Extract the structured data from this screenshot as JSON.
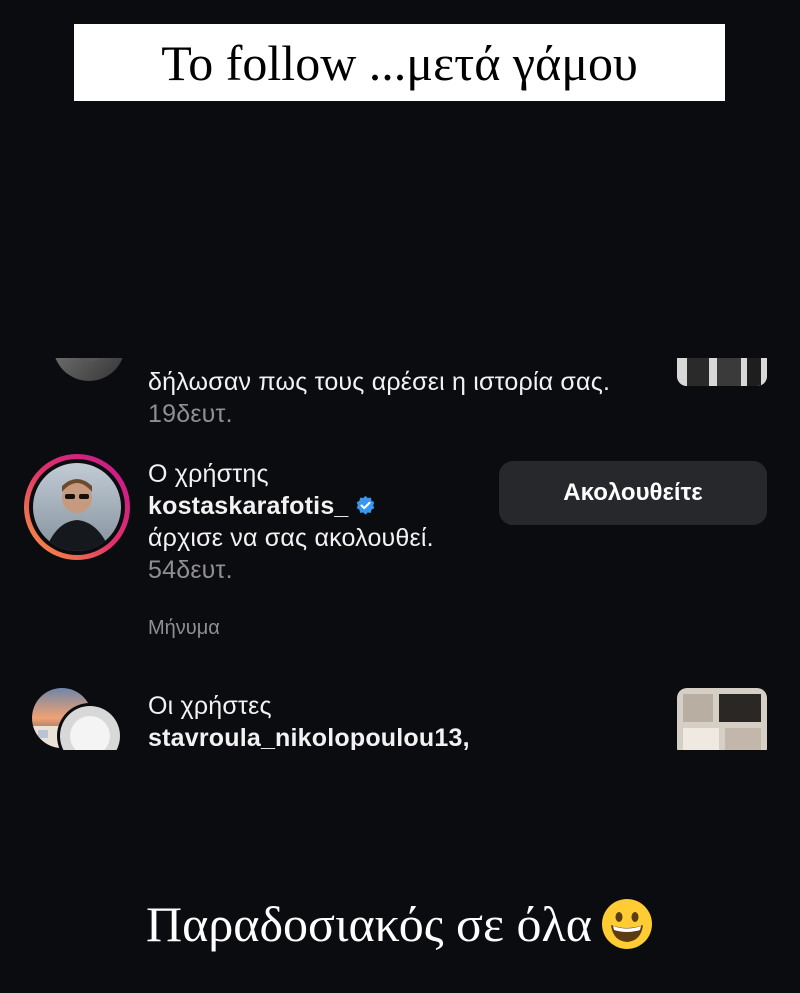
{
  "header": {
    "title": "To follow ...μετά γάμου"
  },
  "notifications": [
    {
      "text": "δήλωσαν πως τους αρέσει η ιστορία σας.",
      "time": "19δευτ."
    },
    {
      "prefix": "Ο χρήστης",
      "username": "kostaskarafotis_",
      "verified": true,
      "message": "άρχισε να σας ακολουθεί.",
      "time": "54δευτ.",
      "action_label": "Ακολουθείτε",
      "reply_label": "Μήνυμα"
    },
    {
      "prefix": "Οι χρήστες",
      "usernames": "stavroula_nikolopoulou13,"
    }
  ],
  "caption": {
    "text": "Παραδοσιακός σε όλα",
    "emoji": "grinning-face"
  },
  "colors": {
    "background": "#0b0c0f",
    "button_bg": "#26282c",
    "muted_text": "#8e8e93",
    "verified_blue": "#3897f0",
    "story_ring_start": "#f9a13a",
    "story_ring_end": "#c2178f"
  }
}
